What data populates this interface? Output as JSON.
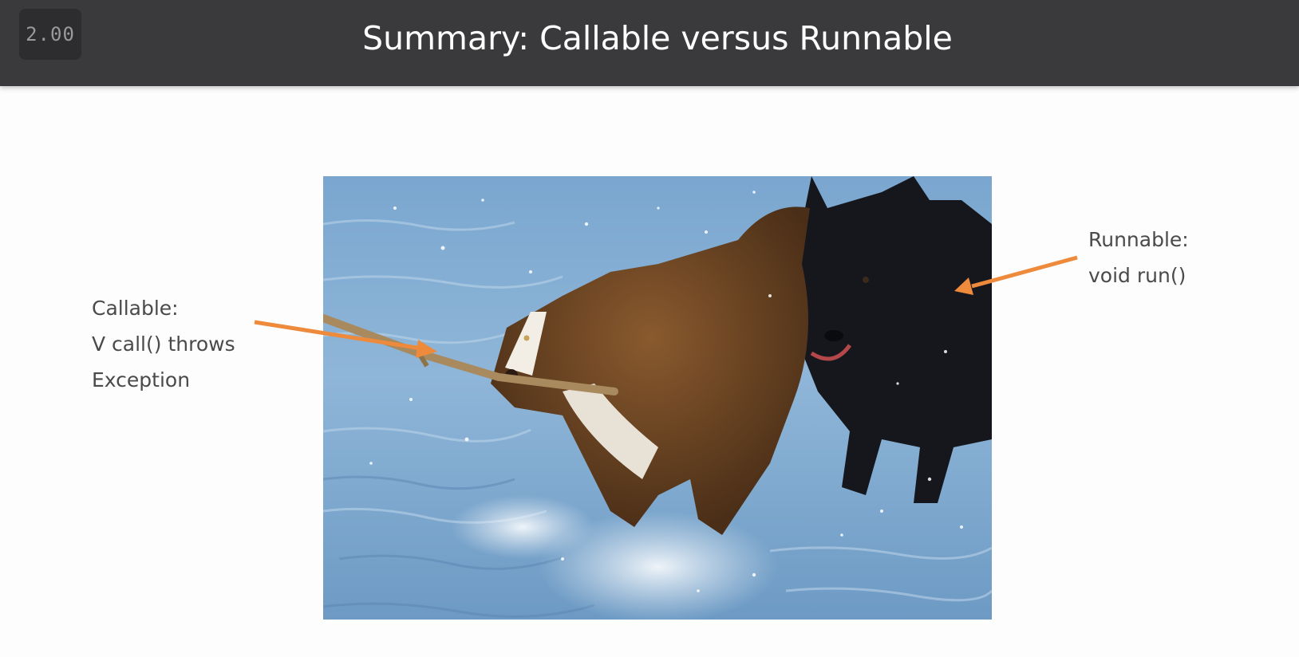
{
  "player": {
    "speed": "2.00"
  },
  "slide": {
    "title": "Summary: Callable versus Runnable",
    "callable": {
      "line1": "Callable:",
      "line2": "V call() throws",
      "line3": "Exception"
    },
    "runnable": {
      "line1": "Runnable:",
      "line2": "void run()"
    },
    "photo": {
      "content": "two-dogs-running-in-water"
    }
  },
  "colors": {
    "title_bar": "#3a393b",
    "arrow": "#ee8a3c",
    "label_text": "#4a4a4a",
    "background": "#fdfdfd"
  }
}
